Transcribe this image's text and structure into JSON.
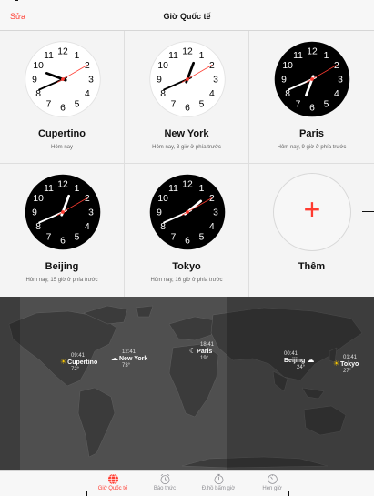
{
  "navbar": {
    "edit_label": "Sửa",
    "title": "Giờ Quốc tế"
  },
  "clocks": [
    {
      "city": "Cupertino",
      "subtitle": "Hôm nay",
      "theme": "light",
      "time": "09:41"
    },
    {
      "city": "New York",
      "subtitle": "Hôm nay, 3 giờ ở phía trước",
      "theme": "light",
      "time": "12:41"
    },
    {
      "city": "Paris",
      "subtitle": "Hôm nay, 9 giờ ở phía trước",
      "theme": "dark",
      "time": "18:41"
    },
    {
      "city": "Beijing",
      "subtitle": "Hôm nay, 15 giờ ở phía trước",
      "theme": "dark",
      "time": "00:41"
    },
    {
      "city": "Tokyo",
      "subtitle": "Hôm nay, 16 giờ ở phía trước",
      "theme": "dark",
      "time": "01:41"
    }
  ],
  "add_tile": {
    "label": "Thêm",
    "icon": "plus-icon"
  },
  "map_pins": [
    {
      "time": "09:41",
      "city": "Cupertino",
      "temp": "72°",
      "weather_icon": "sun-icon"
    },
    {
      "time": "12:41",
      "city": "New York",
      "temp": "73°",
      "weather_icon": "cloud-icon"
    },
    {
      "time": "18:41",
      "city": "Paris",
      "temp": "19°",
      "weather_icon": "moon-icon"
    },
    {
      "time": "00:41",
      "city": "Beijing",
      "temp": "24°",
      "weather_icon": "cloud-icon"
    },
    {
      "time": "01:41",
      "city": "Tokyo",
      "temp": "27°",
      "weather_icon": "sun-icon"
    }
  ],
  "tabs": [
    {
      "label": "Giờ Quốc tế",
      "icon": "globe-icon",
      "active": true
    },
    {
      "label": "Báo thức",
      "icon": "alarm-clock-icon",
      "active": false
    },
    {
      "label": "Đ.hồ bấm giờ",
      "icon": "stopwatch-icon",
      "active": false
    },
    {
      "label": "Hẹn giờ",
      "icon": "timer-icon",
      "active": false
    }
  ],
  "colors": {
    "accent": "#ff3b30",
    "clock_light_face": "#ffffff",
    "clock_dark_face": "#000000",
    "map_land": "#3a3a3a",
    "map_water": "#555555"
  }
}
